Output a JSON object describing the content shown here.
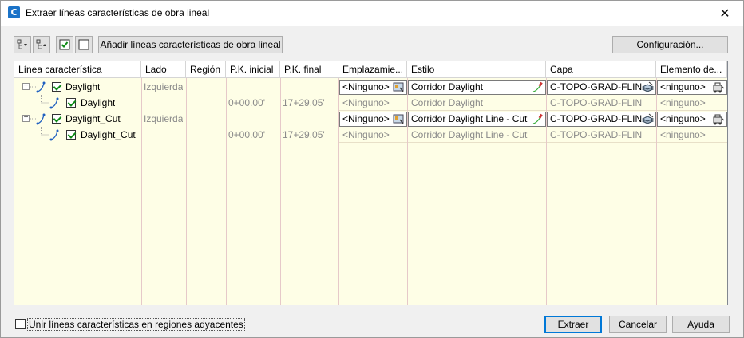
{
  "window": {
    "title": "Extraer líneas características de obra lineal",
    "close_glyph": "✕"
  },
  "toolbar": {
    "add_button_label": "Añadir líneas características de obra lineal",
    "settings_button_label": "Configuración..."
  },
  "grid": {
    "columns": [
      "Línea característica",
      "Lado",
      "Región",
      "P.K. inicial",
      "P.K. final",
      "Emplazamie...",
      "Estilo",
      "Capa",
      "Elemento de..."
    ],
    "rows": [
      {
        "level": 0,
        "name": "Daylight",
        "checked": true,
        "side": "Izquierda",
        "region": "",
        "start": "",
        "end": "",
        "site": "<Ninguno>",
        "style": "Corridor Daylight",
        "layer": "C-TOPO-GRAD-FLIN",
        "element": "<ninguno>"
      },
      {
        "level": 1,
        "name": "Daylight",
        "checked": true,
        "side": "",
        "region": "",
        "start": "0+00.00'",
        "end": "17+29.05'",
        "site": "<Ninguno>",
        "style": "Corridor Daylight",
        "layer": "C-TOPO-GRAD-FLIN",
        "element": "<ninguno>"
      },
      {
        "level": 0,
        "name": "Daylight_Cut",
        "checked": true,
        "side": "Izquierda",
        "region": "",
        "start": "",
        "end": "",
        "site": "<Ninguno>",
        "style": "Corridor Daylight Line - Cut",
        "layer": "C-TOPO-GRAD-FLIN",
        "element": "<ninguno>"
      },
      {
        "level": 1,
        "name": "Daylight_Cut",
        "checked": true,
        "side": "",
        "region": "",
        "start": "0+00.00'",
        "end": "17+29.05'",
        "site": "<Ninguno>",
        "style": "Corridor Daylight Line - Cut",
        "layer": "C-TOPO-GRAD-FLIN",
        "element": "<ninguno>"
      }
    ]
  },
  "footer": {
    "join_label": "Unir líneas características en regiones adyacentes",
    "join_checked": false,
    "extract_label": "Extraer",
    "cancel_label": "Cancelar",
    "help_label": "Ayuda"
  },
  "colors": {
    "grid_background": "#fefee6",
    "check_green": "#0e8a16",
    "focus_blue": "#0078d7"
  }
}
